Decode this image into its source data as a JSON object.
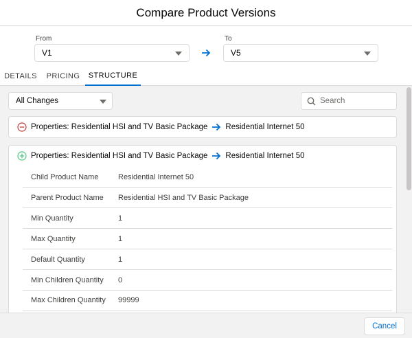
{
  "modal": {
    "title": "Compare Product Versions"
  },
  "from": {
    "label": "From",
    "value": "V1"
  },
  "to": {
    "label": "To",
    "value": "V5"
  },
  "tabs": [
    {
      "label": "DETAILS",
      "active": false
    },
    {
      "label": "PRICING",
      "active": false
    },
    {
      "label": "STRUCTURE",
      "active": true
    }
  ],
  "filter": {
    "value": "All Changes"
  },
  "search": {
    "placeholder": "Search"
  },
  "changes": [
    {
      "type": "removed",
      "source": "Properties: Residential HSI and TV Basic Package",
      "target": "Residential Internet 50"
    },
    {
      "type": "added",
      "source": "Properties: Residential HSI and TV Basic Package",
      "target": "Residential Internet 50",
      "details": [
        {
          "key": "Child Product Name",
          "value": "Residential Internet 50"
        },
        {
          "key": "Parent Product Name",
          "value": "Residential HSI and TV Basic Package"
        },
        {
          "key": "Min Quantity",
          "value": "1"
        },
        {
          "key": "Max Quantity",
          "value": "1"
        },
        {
          "key": "Default Quantity",
          "value": "1"
        },
        {
          "key": "Min Children Quantity",
          "value": "0"
        },
        {
          "key": "Max Children Quantity",
          "value": "99999"
        }
      ]
    }
  ],
  "footer": {
    "cancel_label": "Cancel"
  },
  "colors": {
    "accent": "#0070d2",
    "removed": "#c23934",
    "added": "#4bca81"
  }
}
